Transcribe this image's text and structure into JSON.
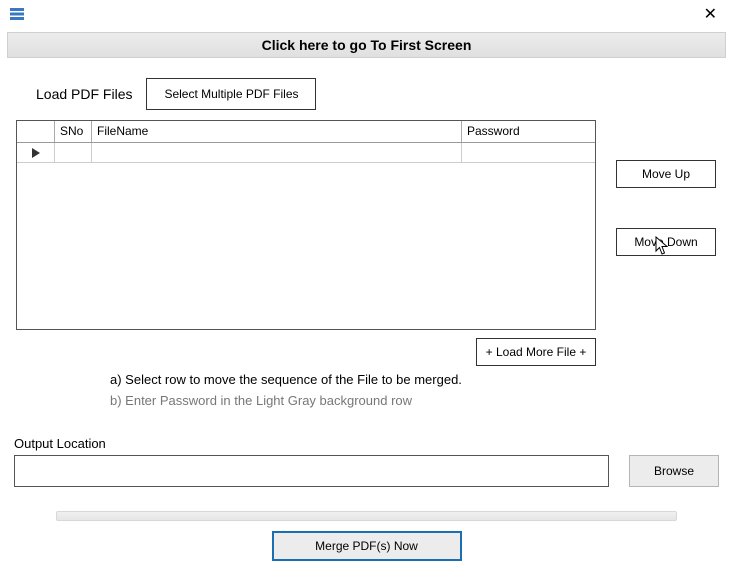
{
  "banner": {
    "text": "Click here to go To First Screen"
  },
  "load": {
    "label": "Load PDF Files",
    "select_btn": "Select Multiple PDF Files"
  },
  "grid": {
    "headers": {
      "sno": "SNo",
      "filename": "FileName",
      "password": "Password"
    }
  },
  "side": {
    "move_up": "Move Up",
    "move_down": "Move Down"
  },
  "load_more": "+ Load More File +",
  "instructions": {
    "a": "a) Select row to move the sequence of the File to be merged.",
    "b": "b) Enter Password in the Light Gray background row"
  },
  "output": {
    "label": "Output Location",
    "value": "",
    "browse": "Browse"
  },
  "merge": "Merge  PDF(s) Now"
}
